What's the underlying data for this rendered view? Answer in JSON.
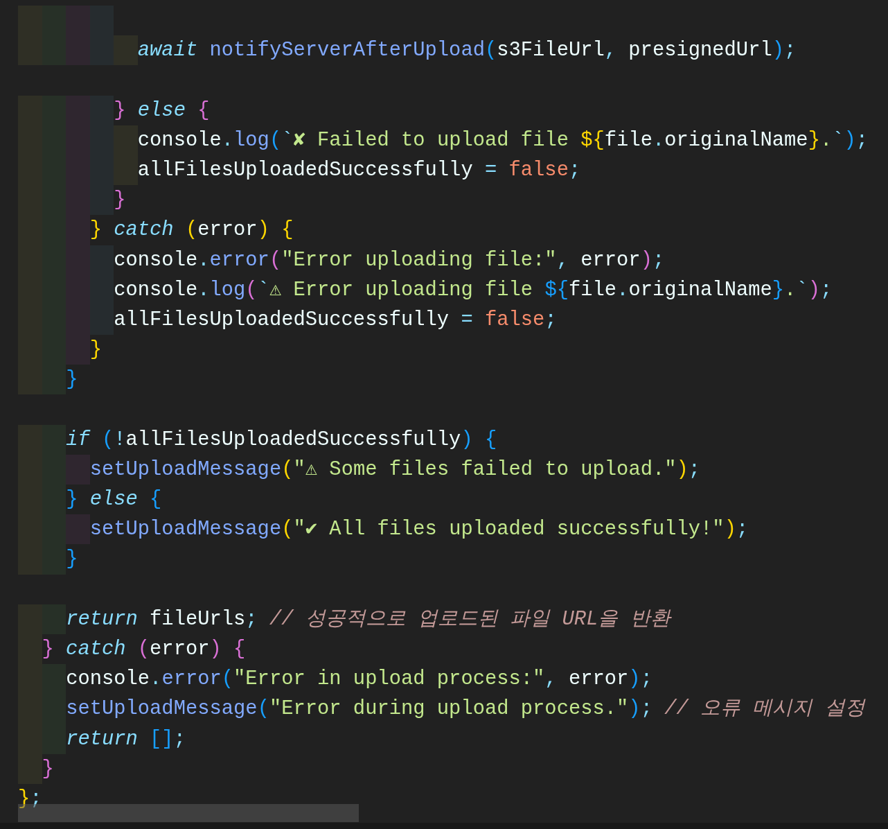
{
  "editor": {
    "lines": [
      {
        "kind": "guides"
      },
      {
        "kind": "code",
        "tokens": [
          {
            "kind": "kw",
            "text": "          await"
          },
          {
            "kind": "fn",
            "text": " notifyServerAfterUpload"
          },
          {
            "kind": "b3",
            "text": "("
          },
          {
            "kind": "var",
            "text": "s3FileUrl"
          },
          {
            "kind": "punct",
            "text": ","
          },
          {
            "kind": "var",
            "text": " presignedUrl"
          },
          {
            "kind": "b3",
            "text": ")"
          },
          {
            "kind": "punct",
            "text": ";"
          }
        ]
      },
      {
        "kind": "blank"
      },
      {
        "kind": "code",
        "tokens": [
          {
            "kind": "b2",
            "text": "        }"
          },
          {
            "kind": "kw",
            "text": " else"
          },
          {
            "kind": "b2",
            "text": " {"
          }
        ]
      },
      {
        "kind": "code",
        "tokens": [
          {
            "kind": "var",
            "text": "          console"
          },
          {
            "kind": "punct",
            "text": "."
          },
          {
            "kind": "fn",
            "text": "log"
          },
          {
            "kind": "b3",
            "text": "("
          },
          {
            "kind": "punct",
            "text": "`"
          },
          {
            "kind": "str",
            "text": "✘ Failed to upload file "
          },
          {
            "kind": "b1",
            "text": "${"
          },
          {
            "kind": "var",
            "text": "file"
          },
          {
            "kind": "punct",
            "text": "."
          },
          {
            "kind": "var",
            "text": "originalName"
          },
          {
            "kind": "b1",
            "text": "}"
          },
          {
            "kind": "str",
            "text": "."
          },
          {
            "kind": "punct",
            "text": "`"
          },
          {
            "kind": "b3",
            "text": ")"
          },
          {
            "kind": "punct",
            "text": ";"
          }
        ]
      },
      {
        "kind": "code",
        "tokens": [
          {
            "kind": "var",
            "text": "          allFilesUploadedSuccessfully"
          },
          {
            "kind": "punct",
            "text": " ="
          },
          {
            "kind": "bool",
            "text": " false"
          },
          {
            "kind": "punct",
            "text": ";"
          }
        ]
      },
      {
        "kind": "code",
        "tokens": [
          {
            "kind": "b2",
            "text": "        }"
          }
        ]
      },
      {
        "kind": "code",
        "tokens": [
          {
            "kind": "b1",
            "text": "      }"
          },
          {
            "kind": "kw",
            "text": " catch"
          },
          {
            "kind": "b1",
            "text": " ("
          },
          {
            "kind": "var",
            "text": "error"
          },
          {
            "kind": "b1",
            "text": ") {"
          }
        ]
      },
      {
        "kind": "code",
        "tokens": [
          {
            "kind": "var",
            "text": "        console"
          },
          {
            "kind": "punct",
            "text": "."
          },
          {
            "kind": "fn",
            "text": "error"
          },
          {
            "kind": "b2",
            "text": "("
          },
          {
            "kind": "str",
            "text": "\"Error uploading file:\""
          },
          {
            "kind": "punct",
            "text": ","
          },
          {
            "kind": "var",
            "text": " error"
          },
          {
            "kind": "b2",
            "text": ")"
          },
          {
            "kind": "punct",
            "text": ";"
          }
        ]
      },
      {
        "kind": "code",
        "tokens": [
          {
            "kind": "var",
            "text": "        console"
          },
          {
            "kind": "punct",
            "text": "."
          },
          {
            "kind": "fn",
            "text": "log"
          },
          {
            "kind": "b2",
            "text": "("
          },
          {
            "kind": "punct",
            "text": "`"
          },
          {
            "kind": "str",
            "text": "⚠ Error uploading file "
          },
          {
            "kind": "b3",
            "text": "${"
          },
          {
            "kind": "var",
            "text": "file"
          },
          {
            "kind": "punct",
            "text": "."
          },
          {
            "kind": "var",
            "text": "originalName"
          },
          {
            "kind": "b3",
            "text": "}"
          },
          {
            "kind": "str",
            "text": "."
          },
          {
            "kind": "punct",
            "text": "`"
          },
          {
            "kind": "b2",
            "text": ")"
          },
          {
            "kind": "punct",
            "text": ";"
          }
        ]
      },
      {
        "kind": "code",
        "tokens": [
          {
            "kind": "var",
            "text": "        allFilesUploadedSuccessfully"
          },
          {
            "kind": "punct",
            "text": " ="
          },
          {
            "kind": "bool",
            "text": " false"
          },
          {
            "kind": "punct",
            "text": ";"
          }
        ]
      },
      {
        "kind": "code",
        "tokens": [
          {
            "kind": "b1",
            "text": "      }"
          }
        ]
      },
      {
        "kind": "code",
        "tokens": [
          {
            "kind": "b3",
            "text": "    }"
          }
        ]
      },
      {
        "kind": "blank"
      },
      {
        "kind": "code",
        "tokens": [
          {
            "kind": "kw",
            "text": "    if"
          },
          {
            "kind": "b3",
            "text": " ("
          },
          {
            "kind": "punct",
            "text": "!"
          },
          {
            "kind": "var",
            "text": "allFilesUploadedSuccessfully"
          },
          {
            "kind": "b3",
            "text": ") {"
          }
        ]
      },
      {
        "kind": "code",
        "tokens": [
          {
            "kind": "fn",
            "text": "      setUploadMessage"
          },
          {
            "kind": "b1",
            "text": "("
          },
          {
            "kind": "str",
            "text": "\"⚠ Some files failed to upload.\""
          },
          {
            "kind": "b1",
            "text": ")"
          },
          {
            "kind": "punct",
            "text": ";"
          }
        ]
      },
      {
        "kind": "code",
        "tokens": [
          {
            "kind": "b3",
            "text": "    }"
          },
          {
            "kind": "kw",
            "text": " else"
          },
          {
            "kind": "b3",
            "text": " {"
          }
        ]
      },
      {
        "kind": "code",
        "tokens": [
          {
            "kind": "fn",
            "text": "      setUploadMessage"
          },
          {
            "kind": "b1",
            "text": "("
          },
          {
            "kind": "str",
            "text": "\"✔ All files uploaded successfully!\""
          },
          {
            "kind": "b1",
            "text": ")"
          },
          {
            "kind": "punct",
            "text": ";"
          }
        ]
      },
      {
        "kind": "code",
        "tokens": [
          {
            "kind": "b3",
            "text": "    }"
          }
        ]
      },
      {
        "kind": "blank"
      },
      {
        "kind": "code",
        "tokens": [
          {
            "kind": "kw",
            "text": "    return"
          },
          {
            "kind": "var",
            "text": " fileUrls"
          },
          {
            "kind": "punct",
            "text": ";"
          },
          {
            "kind": "comment",
            "text": " // 성공적으로 업로드된 파일 URL을 반환"
          }
        ]
      },
      {
        "kind": "code",
        "tokens": [
          {
            "kind": "b2",
            "text": "  }"
          },
          {
            "kind": "kw",
            "text": " catch"
          },
          {
            "kind": "b2",
            "text": " ("
          },
          {
            "kind": "var",
            "text": "error"
          },
          {
            "kind": "b2",
            "text": ") {"
          }
        ]
      },
      {
        "kind": "code",
        "tokens": [
          {
            "kind": "var",
            "text": "    console"
          },
          {
            "kind": "punct",
            "text": "."
          },
          {
            "kind": "fn",
            "text": "error"
          },
          {
            "kind": "b3",
            "text": "("
          },
          {
            "kind": "str",
            "text": "\"Error in upload process:\""
          },
          {
            "kind": "punct",
            "text": ","
          },
          {
            "kind": "var",
            "text": " error"
          },
          {
            "kind": "b3",
            "text": ")"
          },
          {
            "kind": "punct",
            "text": ";"
          }
        ]
      },
      {
        "kind": "code",
        "tokens": [
          {
            "kind": "fn",
            "text": "    setUploadMessage"
          },
          {
            "kind": "b3",
            "text": "("
          },
          {
            "kind": "str",
            "text": "\"Error during upload process.\""
          },
          {
            "kind": "b3",
            "text": ")"
          },
          {
            "kind": "punct",
            "text": ";"
          },
          {
            "kind": "comment",
            "text": " // 오류 메시지 설정"
          }
        ]
      },
      {
        "kind": "code",
        "tokens": [
          {
            "kind": "kw",
            "text": "    return"
          },
          {
            "kind": "b3",
            "text": " []"
          },
          {
            "kind": "punct",
            "text": ";"
          }
        ]
      },
      {
        "kind": "code",
        "tokens": [
          {
            "kind": "b2",
            "text": "  }"
          }
        ]
      },
      {
        "kind": "code",
        "tokens": [
          {
            "kind": "b1",
            "text": "}"
          },
          {
            "kind": "punct",
            "text": ";"
          }
        ]
      }
    ]
  }
}
